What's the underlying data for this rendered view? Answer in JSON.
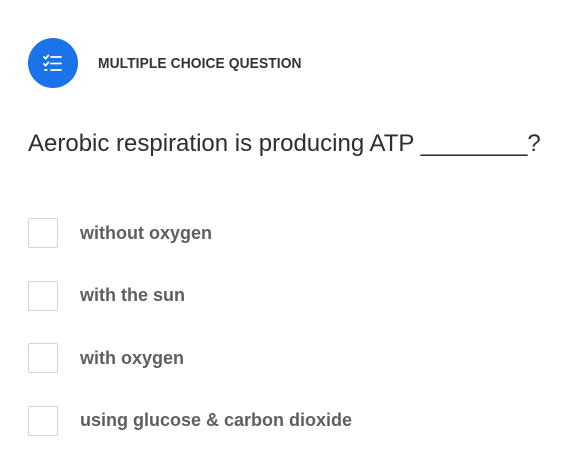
{
  "question_type": {
    "label": "MULTIPLE CHOICE QUESTION",
    "icon": "checklist-icon",
    "color": "#1a73e8"
  },
  "question": {
    "text": "Aerobic respiration is producing ATP ________?"
  },
  "options": [
    {
      "label": "without oxygen",
      "checked": false
    },
    {
      "label": "with the sun",
      "checked": false
    },
    {
      "label": "with oxygen",
      "checked": false
    },
    {
      "label": "using glucose & carbon dioxide",
      "checked": false
    }
  ]
}
